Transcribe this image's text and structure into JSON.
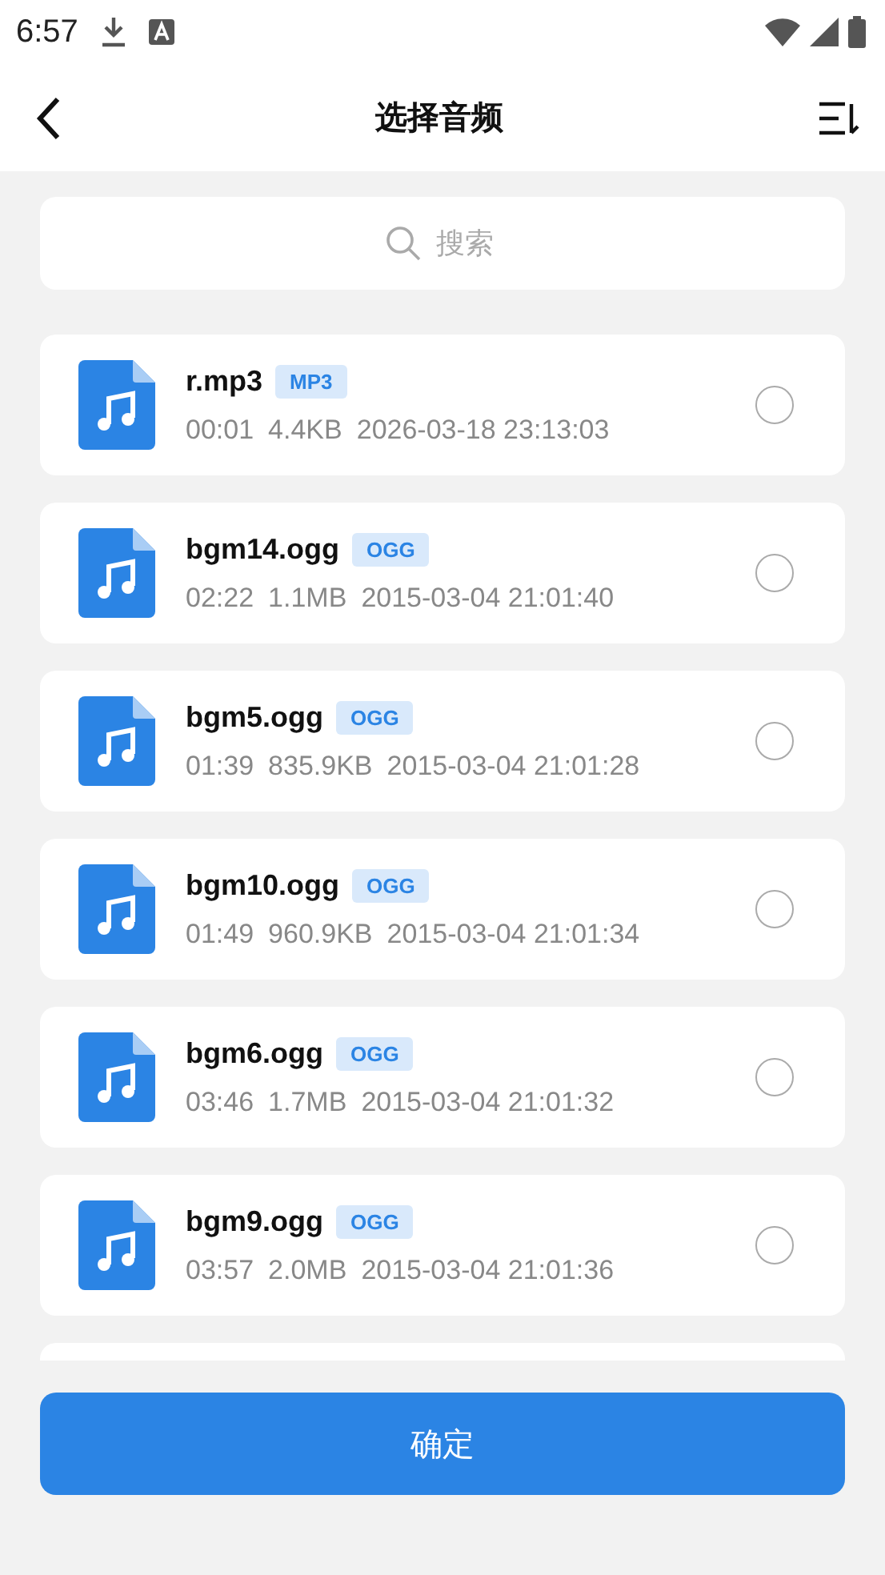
{
  "status_bar": {
    "time": "6:57"
  },
  "header": {
    "title": "选择音频"
  },
  "search": {
    "placeholder": "搜索"
  },
  "files": [
    {
      "name": "r.mp3",
      "tag": "MP3",
      "duration": "00:01",
      "size": "4.4KB",
      "date": "2026-03-18 23:13:03",
      "selected": false
    },
    {
      "name": "bgm14.ogg",
      "tag": "OGG",
      "duration": "02:22",
      "size": "1.1MB",
      "date": "2015-03-04 21:01:40",
      "selected": false
    },
    {
      "name": "bgm5.ogg",
      "tag": "OGG",
      "duration": "01:39",
      "size": "835.9KB",
      "date": "2015-03-04 21:01:28",
      "selected": false
    },
    {
      "name": "bgm10.ogg",
      "tag": "OGG",
      "duration": "01:49",
      "size": "960.9KB",
      "date": "2015-03-04 21:01:34",
      "selected": false
    },
    {
      "name": "bgm6.ogg",
      "tag": "OGG",
      "duration": "03:46",
      "size": "1.7MB",
      "date": "2015-03-04 21:01:32",
      "selected": false
    },
    {
      "name": "bgm9.ogg",
      "tag": "OGG",
      "duration": "03:57",
      "size": "2.0MB",
      "date": "2015-03-04 21:01:36",
      "selected": false
    }
  ],
  "confirm_button": {
    "label": "确定"
  }
}
